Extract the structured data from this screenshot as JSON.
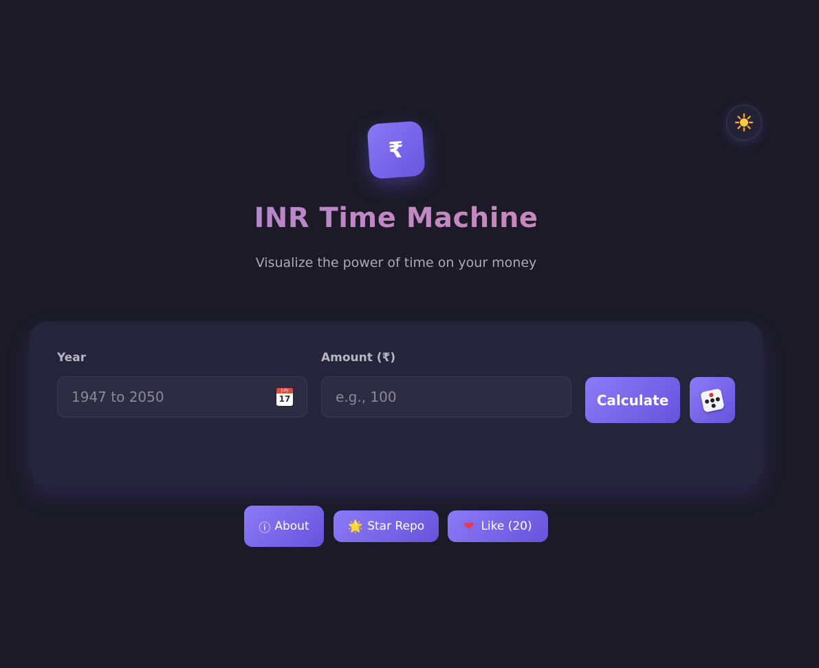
{
  "header": {
    "logo_symbol": "₹",
    "title": "INR Time Machine",
    "subtitle": "Visualize the power of time on your money",
    "theme_toggle_icon": "sun-icon"
  },
  "form": {
    "year_label": "Year",
    "year_placeholder": "1947 to 2050",
    "year_icon": "calendar-icon",
    "calendar_day": "17",
    "calendar_month": "July",
    "amount_label": "Amount (₹)",
    "amount_placeholder": "e.g., 100",
    "calculate_label": "Calculate",
    "random_icon": "dice-icon"
  },
  "footer": {
    "about_glyph": "ⓘ",
    "about_label": "About",
    "star_glyph": "🌟",
    "star_label": "Star Repo",
    "like_glyph": "❤",
    "like_label": "Like (20)"
  },
  "colors": {
    "background": "#1b1a26",
    "card": "#25243a",
    "accent_start": "#8b7bf7",
    "accent_end": "#6852dc",
    "title_gradient_start": "#a985d6",
    "title_gradient_end": "#d88ab0"
  }
}
